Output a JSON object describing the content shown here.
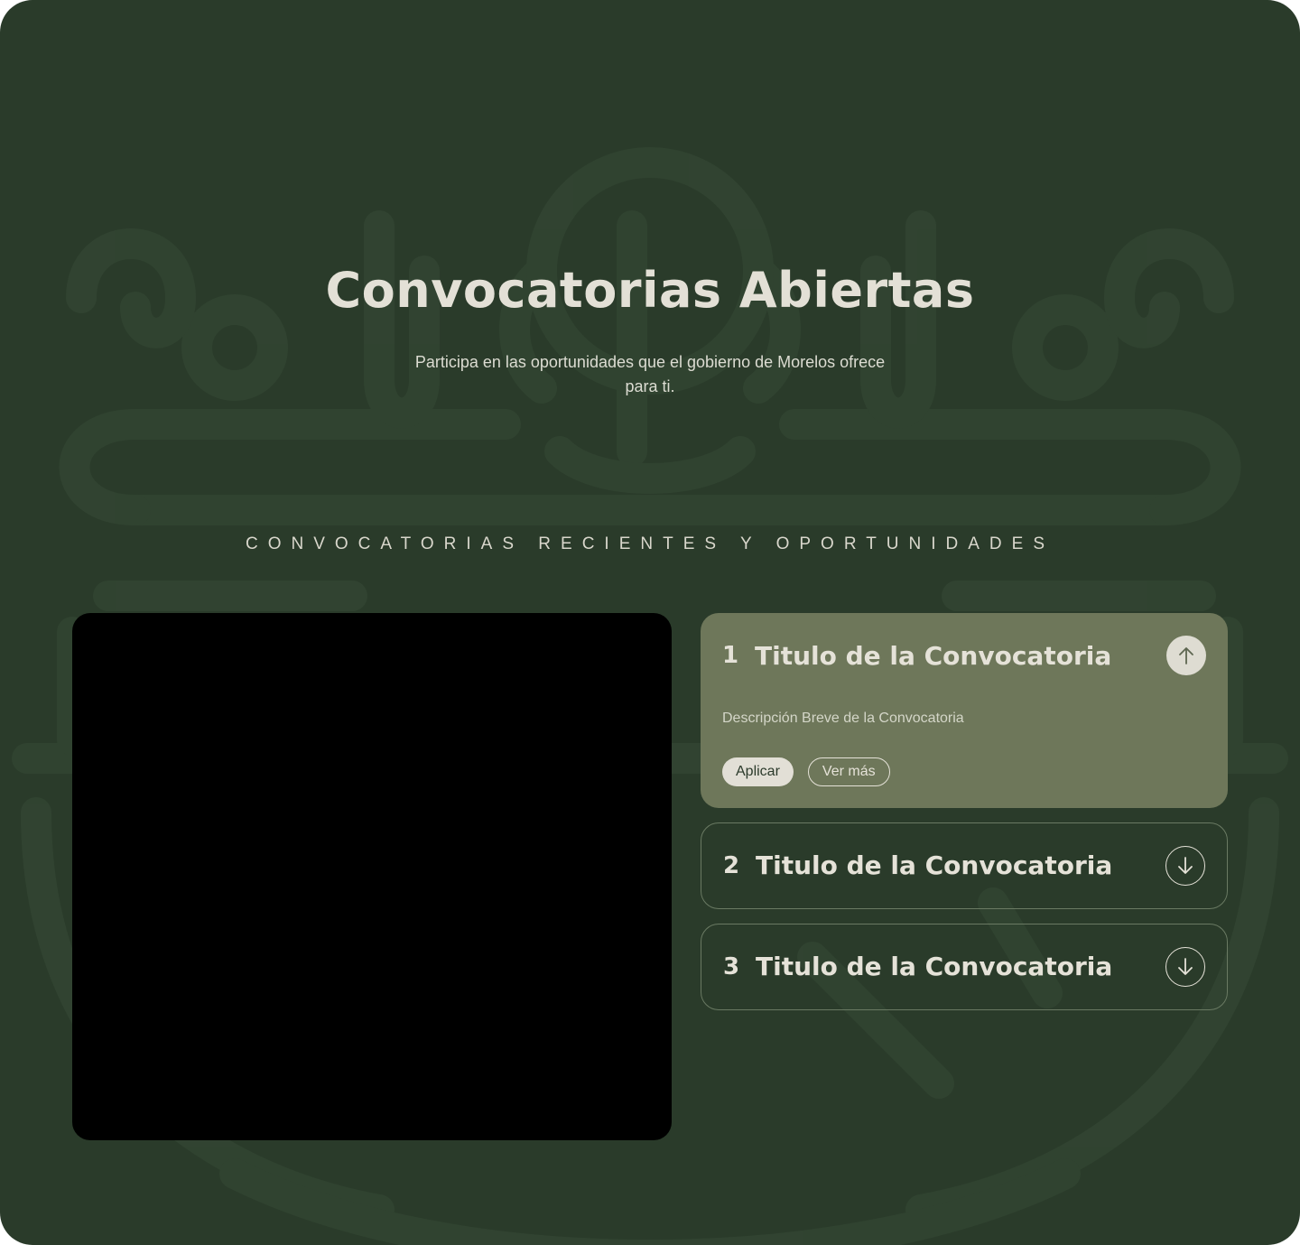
{
  "hero": {
    "title": "Convocatorias Abiertas",
    "subtitle": "Participa en las oportunidades que el gobierno de Morelos ofrece para ti."
  },
  "section": {
    "label": "CONVOCATORIAS RECIENTES Y OPORTUNIDADES"
  },
  "accordion": {
    "items": [
      {
        "number": "1",
        "title": "Titulo de la Convocatoria",
        "description": "Descripción Breve de la Convocatoria",
        "apply_label": "Aplicar",
        "more_label": "Ver más",
        "expanded": true,
        "toggle_icon": "arrow-up-icon"
      },
      {
        "number": "2",
        "title": "Titulo de la Convocatoria",
        "expanded": false,
        "toggle_icon": "arrow-down-icon"
      },
      {
        "number": "3",
        "title": "Titulo de la Convocatoria",
        "expanded": false,
        "toggle_icon": "arrow-down-icon"
      }
    ]
  },
  "colors": {
    "background": "#2a3b2a",
    "card_active": "#6e775a",
    "text_light": "#e3e0d6",
    "video_panel": "#000000"
  }
}
